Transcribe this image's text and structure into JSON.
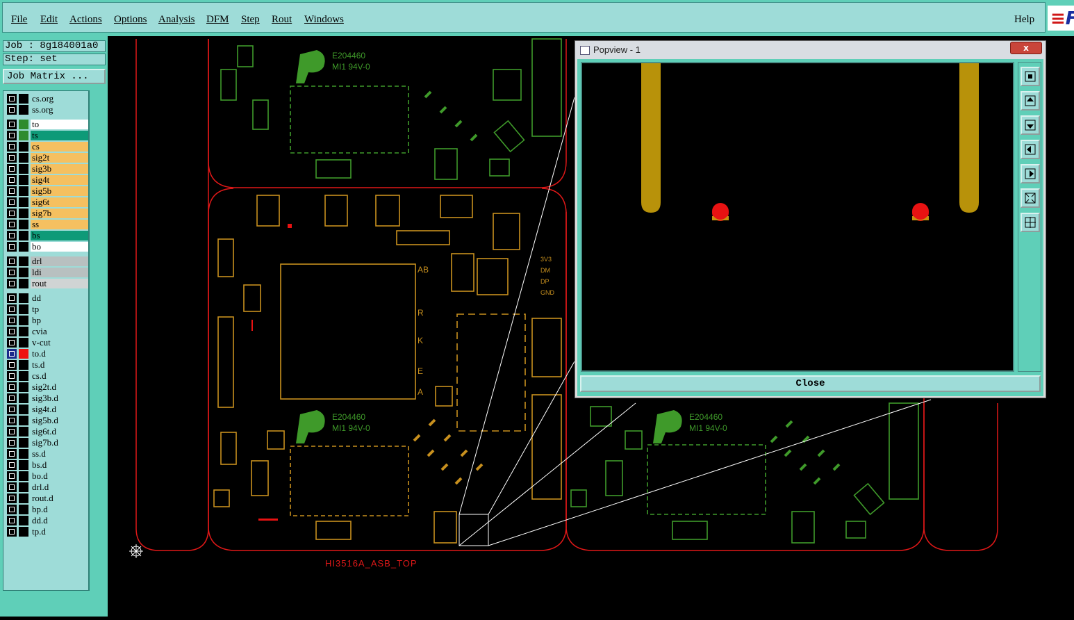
{
  "menubar": {
    "items": [
      "File",
      "Edit",
      "Actions",
      "Options",
      "Analysis",
      "DFM",
      "Step",
      "Rout",
      "Windows"
    ],
    "help": "Help"
  },
  "job": {
    "job_label": "Job : 8g184001a0",
    "step_label": "Step: set",
    "matrix_button": "Job Matrix ..."
  },
  "layers": [
    {
      "name": "cs.org",
      "swatch": "#000000",
      "fill": "#9edcd8"
    },
    {
      "name": "ss.org",
      "swatch": "#000000",
      "fill": "#9edcd8"
    },
    {
      "name": "to",
      "swatch": "#2e8b2e",
      "fill": "#ffffff"
    },
    {
      "name": "ts",
      "swatch": "#2e8b2e",
      "fill": "#0e9a78"
    },
    {
      "name": "cs",
      "swatch": "#000000",
      "fill": "#f5c060"
    },
    {
      "name": "sig2t",
      "swatch": "#000000",
      "fill": "#f5c060"
    },
    {
      "name": "sig3b",
      "swatch": "#000000",
      "fill": "#f5c060"
    },
    {
      "name": "sig4t",
      "swatch": "#000000",
      "fill": "#f5c060"
    },
    {
      "name": "sig5b",
      "swatch": "#000000",
      "fill": "#f5c060"
    },
    {
      "name": "sig6t",
      "swatch": "#000000",
      "fill": "#f5c060"
    },
    {
      "name": "sig7b",
      "swatch": "#000000",
      "fill": "#f5c060"
    },
    {
      "name": "ss",
      "swatch": "#000000",
      "fill": "#f5c060"
    },
    {
      "name": "bs",
      "swatch": "#000000",
      "fill": "#0e9a78"
    },
    {
      "name": "bo",
      "swatch": "#000000",
      "fill": "#ffffff"
    },
    {
      "name": "drl",
      "swatch": "#000000",
      "fill": "#b8c0c0"
    },
    {
      "name": "ldi",
      "swatch": "#000000",
      "fill": "#b8c0c0"
    },
    {
      "name": "rout",
      "swatch": "#000000",
      "fill": "#d0d4d4"
    },
    {
      "name": "dd",
      "swatch": "#000000",
      "fill": "#9edcd8"
    },
    {
      "name": "tp",
      "swatch": "#000000",
      "fill": "#9edcd8"
    },
    {
      "name": "bp",
      "swatch": "#000000",
      "fill": "#9edcd8"
    },
    {
      "name": "cvia",
      "swatch": "#000000",
      "fill": "#9edcd8"
    },
    {
      "name": "v-cut",
      "swatch": "#000000",
      "fill": "#9edcd8"
    },
    {
      "name": "to.d",
      "swatch": "#ee1111",
      "fill": "#9edcd8",
      "active": true
    },
    {
      "name": "ts.d",
      "swatch": "#000000",
      "fill": "#9edcd8"
    },
    {
      "name": "cs.d",
      "swatch": "#000000",
      "fill": "#9edcd8"
    },
    {
      "name": "sig2t.d",
      "swatch": "#000000",
      "fill": "#9edcd8"
    },
    {
      "name": "sig3b.d",
      "swatch": "#000000",
      "fill": "#9edcd8"
    },
    {
      "name": "sig4t.d",
      "swatch": "#000000",
      "fill": "#9edcd8"
    },
    {
      "name": "sig5b.d",
      "swatch": "#000000",
      "fill": "#9edcd8"
    },
    {
      "name": "sig6t.d",
      "swatch": "#000000",
      "fill": "#9edcd8"
    },
    {
      "name": "sig7b.d",
      "swatch": "#000000",
      "fill": "#9edcd8"
    },
    {
      "name": "ss.d",
      "swatch": "#000000",
      "fill": "#9edcd8"
    },
    {
      "name": "bs.d",
      "swatch": "#000000",
      "fill": "#9edcd8"
    },
    {
      "name": "bo.d",
      "swatch": "#000000",
      "fill": "#9edcd8"
    },
    {
      "name": "drl.d",
      "swatch": "#000000",
      "fill": "#9edcd8"
    },
    {
      "name": "rout.d",
      "swatch": "#000000",
      "fill": "#9edcd8"
    },
    {
      "name": "bp.d",
      "swatch": "#000000",
      "fill": "#9edcd8"
    },
    {
      "name": "dd.d",
      "swatch": "#000000",
      "fill": "#9edcd8"
    },
    {
      "name": "tp.d",
      "swatch": "#000000",
      "fill": "#9edcd8"
    }
  ],
  "board": {
    "label": "HI3516A_ASB_TOP",
    "marking_top": "E204460",
    "marking_bottom": "MI1 94V-0",
    "side_letters": [
      "AB",
      "R",
      "K",
      "E",
      "A"
    ],
    "net_labels": [
      "3V3",
      "DM",
      "DP",
      "GND"
    ]
  },
  "popview": {
    "title": "Popview - 1",
    "close_button": "Close",
    "title_close_glyph": "x",
    "tools": [
      "zoom-fit-icon",
      "zoom-in-icon",
      "zoom-out-icon",
      "pan-left-icon",
      "pan-right-icon",
      "zoom-home-icon",
      "zoom-area-icon"
    ]
  },
  "colors": {
    "ui_panel": "#5fcfb8",
    "ui_field": "#9edcd8",
    "board_outline": "#e01818",
    "silk_green": "#3f9a2a",
    "copper_orange": "#c8901e",
    "drill_red": "#e81212",
    "trace_gold": "#b8920a"
  }
}
